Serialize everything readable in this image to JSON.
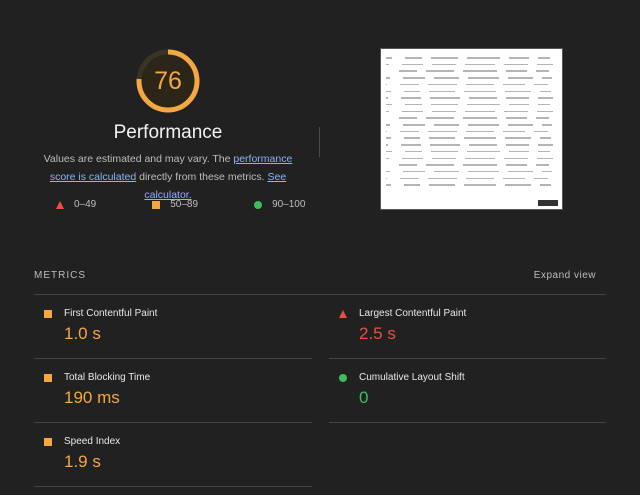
{
  "performance": {
    "score": "76",
    "score_fraction": 0.76,
    "title": "Performance",
    "desc_prefix": "Values are estimated and may vary. The ",
    "link1": "performance score is calculated",
    "desc_middle": " directly from these metrics. ",
    "link2": "See calculator.",
    "accent": "#f5a742"
  },
  "legend": [
    {
      "icon": "triangle",
      "label": "0–49",
      "color": "#e8503f"
    },
    {
      "icon": "square",
      "label": "50–89",
      "color": "#f5a742"
    },
    {
      "icon": "circle",
      "label": "90–100",
      "color": "#3cbe5e"
    }
  ],
  "metrics_header": "METRICS",
  "expand_label": "Expand view",
  "metrics": [
    {
      "name": "First Contentful Paint",
      "value": "1.0 s",
      "status": "average"
    },
    {
      "name": "Largest Contentful Paint",
      "value": "2.5 s",
      "status": "fail"
    },
    {
      "name": "Total Blocking Time",
      "value": "190 ms",
      "status": "average"
    },
    {
      "name": "Cumulative Layout Shift",
      "value": "0",
      "status": "pass"
    },
    {
      "name": "Speed Index",
      "value": "1.9 s",
      "status": "average"
    }
  ],
  "thumbnail": {
    "description_rows": 20,
    "button_label": "Load More"
  }
}
